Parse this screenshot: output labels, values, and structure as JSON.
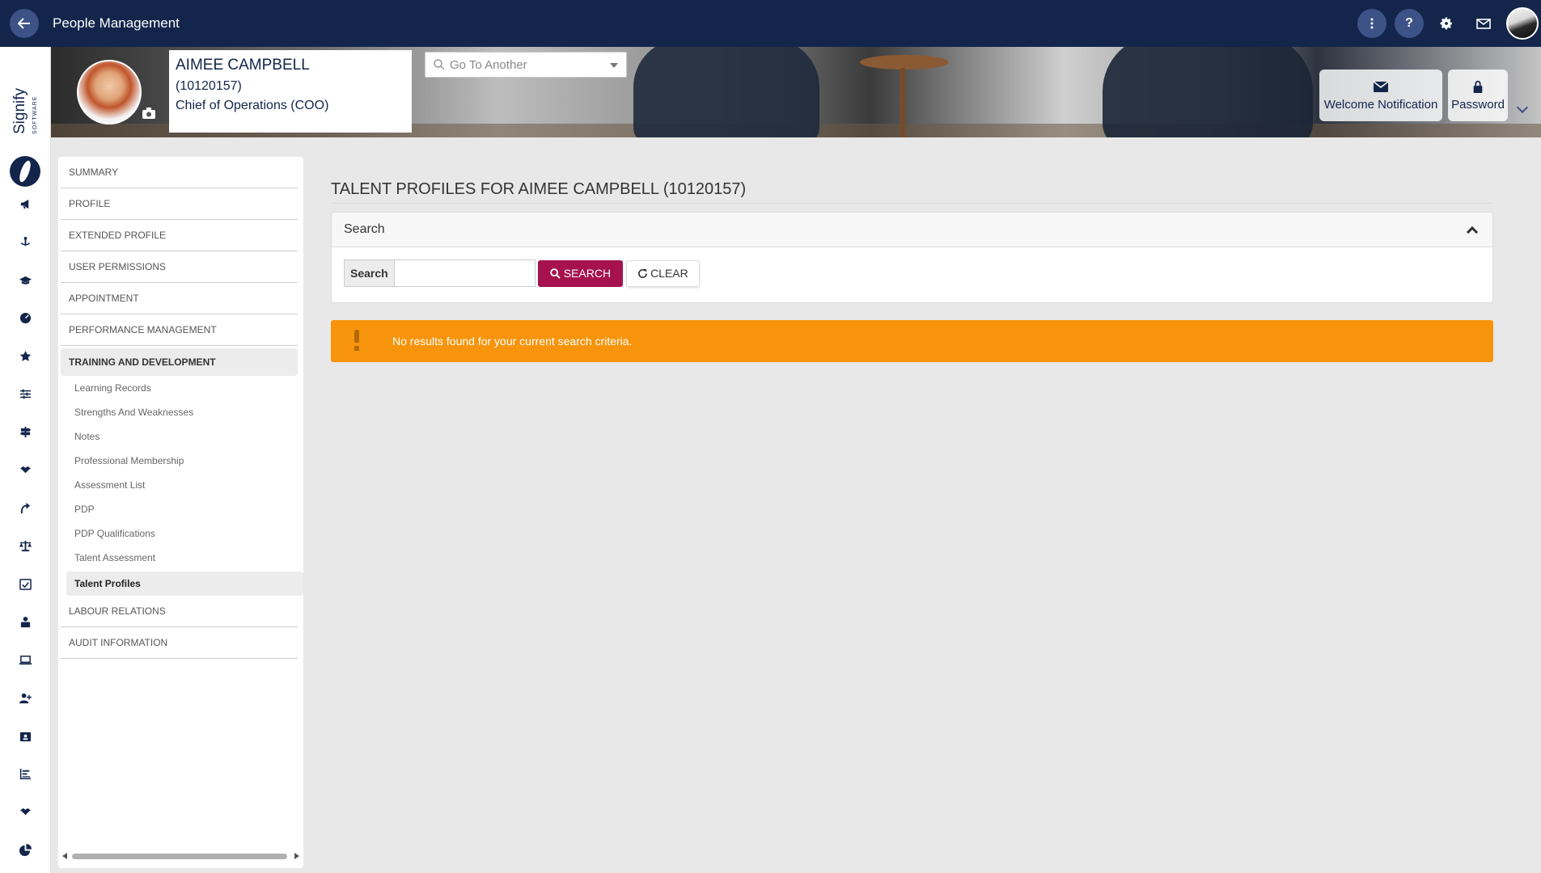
{
  "header": {
    "back_icon": "arrow-left-icon",
    "app_title": "People Management",
    "menu_icon": "more-vertical-icon",
    "help_label": "?",
    "settings_icon": "gear-icon",
    "mail_icon": "mail-icon"
  },
  "brand": {
    "name": "Signify",
    "sub": "SOFTWARE"
  },
  "rail_icons": [
    "megaphone-icon",
    "anchor-icon",
    "graduation-cap-icon",
    "gauge-icon",
    "star-icon",
    "sliders-icon",
    "signpost-icon",
    "handshake-icon",
    "route-icon",
    "scales-icon",
    "calendar-check-icon",
    "person-desk-icon",
    "laptop-icon",
    "user-plus-icon",
    "id-card-icon",
    "bar-chart-icon",
    "handshake-2-icon",
    "pie-chart-icon"
  ],
  "employee": {
    "name": "AIMEE CAMPBELL",
    "number": "(10120157)",
    "job_title": "Chief of Operations (COO)"
  },
  "goto": {
    "placeholder": "Go To Another"
  },
  "banner_buttons": {
    "welcome": "Welcome Notification",
    "password": "Password"
  },
  "nav": {
    "items": [
      "SUMMARY",
      "PROFILE",
      "EXTENDED PROFILE",
      "USER PERMISSIONS",
      "APPOINTMENT",
      "PERFORMANCE MANAGEMENT",
      "TRAINING AND DEVELOPMENT",
      "LABOUR RELATIONS",
      "AUDIT INFORMATION"
    ],
    "sub_items": [
      "Learning Records",
      "Strengths And Weaknesses",
      "Notes",
      "Professional Membership",
      "Assessment List",
      "PDP",
      "PDP Qualifications",
      "Talent Assessment",
      "Talent Profiles"
    ]
  },
  "main": {
    "title": "TALENT PROFILES FOR AIMEE CAMPBELL (10120157)",
    "search_panel_title": "Search",
    "search_addon": "Search",
    "search_value": "",
    "search_button": "SEARCH",
    "clear_button": "CLEAR",
    "alert": "No results found for your current search criteria."
  },
  "colors": {
    "topbar": "#13254b",
    "accent": "#a5124e",
    "alert": "#f7940c"
  }
}
